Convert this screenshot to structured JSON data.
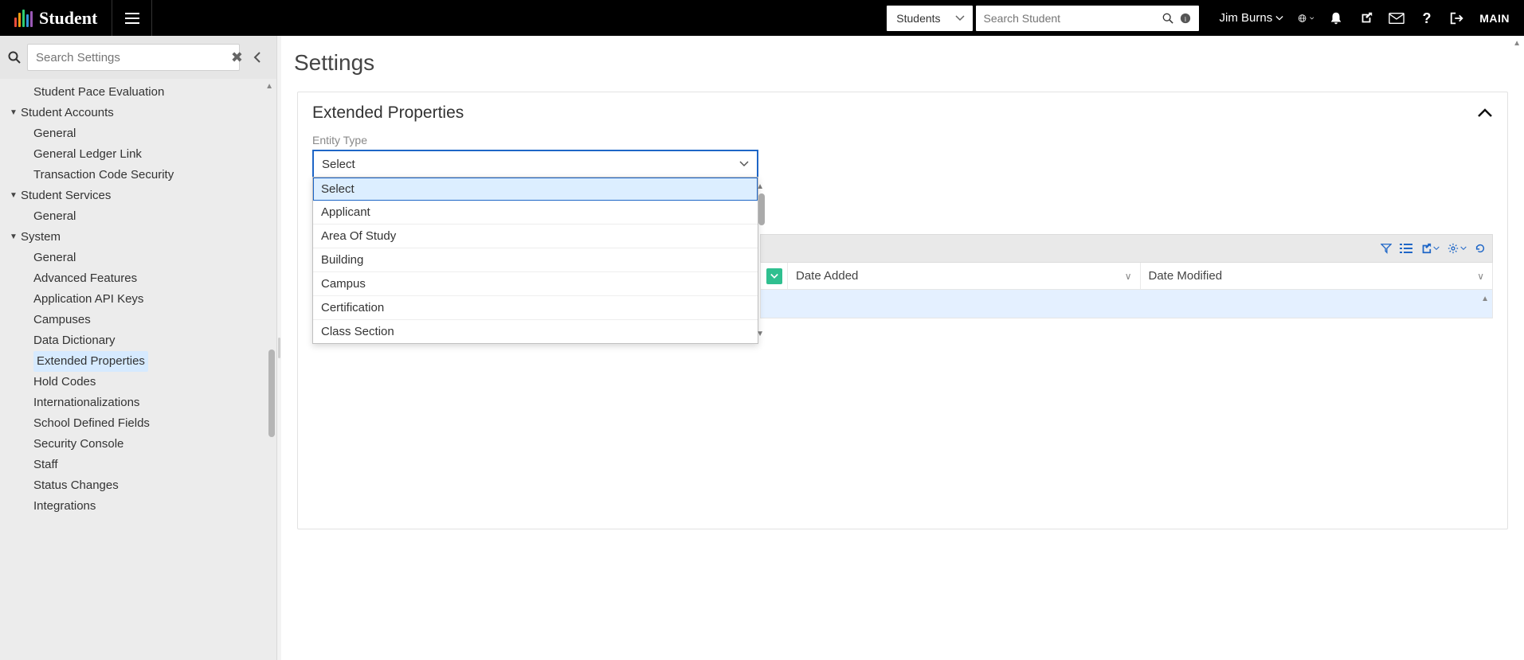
{
  "brand": {
    "name": "Student"
  },
  "topbar": {
    "context_selector": {
      "label": "Students"
    },
    "search": {
      "placeholder": "Search Student"
    },
    "user": {
      "name": "Jim Burns"
    },
    "main_label": "MAIN"
  },
  "sidebar": {
    "search_placeholder": "Search Settings",
    "items": [
      {
        "type": "sub",
        "label": "Student Pace Evaluation"
      },
      {
        "type": "group",
        "label": "Student Accounts"
      },
      {
        "type": "sub",
        "label": "General"
      },
      {
        "type": "sub",
        "label": "General Ledger Link"
      },
      {
        "type": "sub",
        "label": "Transaction Code Security"
      },
      {
        "type": "group",
        "label": "Student Services"
      },
      {
        "type": "sub",
        "label": "General"
      },
      {
        "type": "group",
        "label": "System"
      },
      {
        "type": "sub",
        "label": "General"
      },
      {
        "type": "sub",
        "label": "Advanced Features"
      },
      {
        "type": "sub",
        "label": "Application API Keys"
      },
      {
        "type": "sub",
        "label": "Campuses"
      },
      {
        "type": "sub",
        "label": "Data Dictionary"
      },
      {
        "type": "sub",
        "label": "Extended Properties",
        "active": true
      },
      {
        "type": "sub",
        "label": "Hold Codes"
      },
      {
        "type": "sub",
        "label": "Internationalizations"
      },
      {
        "type": "sub",
        "label": "School Defined Fields"
      },
      {
        "type": "sub",
        "label": "Security Console"
      },
      {
        "type": "sub",
        "label": "Staff"
      },
      {
        "type": "sub",
        "label": "Status Changes"
      },
      {
        "type": "sub",
        "label": "Integrations"
      }
    ]
  },
  "page": {
    "title": "Settings",
    "panel_title": "Extended Properties",
    "entity_type_label": "Entity Type",
    "entity_type_value": "Select",
    "entity_type_options": [
      "Select",
      "Applicant",
      "Area Of Study",
      "Building",
      "Campus",
      "Certification",
      "Class Section"
    ],
    "grid": {
      "columns": [
        "Date Added",
        "Date Modified"
      ]
    }
  }
}
